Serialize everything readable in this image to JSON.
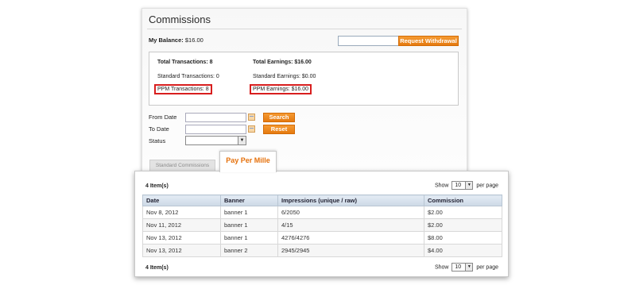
{
  "page": {
    "title": "Commissions",
    "balance_label": "My Balance:",
    "balance_value": "$16.00",
    "withdraw_button": "Request Withdrawal",
    "withdraw_amount": ""
  },
  "summary": {
    "total_transactions": "Total Transactions: 8",
    "standard_transactions": "Standard Transactions: 0",
    "ppm_transactions": "PPM Transactions: 8",
    "total_earnings": "Total Earnings: $16.00",
    "standard_earnings": "Standard Earnings: $0.00",
    "ppm_earnings": "PPM Earnings: $16.00"
  },
  "filters": {
    "from_label": "From Date",
    "to_label": "To Date",
    "status_label": "Status",
    "from_value": "",
    "to_value": "",
    "status_value": "",
    "search_button": "Search",
    "reset_button": "Reset"
  },
  "tabs": {
    "standard": "Standard Commissions",
    "ppm": "Pay Per Mille"
  },
  "grid": {
    "count_top": "4 Item(s)",
    "count_bottom": "4 Item(s)",
    "show_label": "Show",
    "per_page_label": "per page",
    "per_page_value": "10",
    "columns": [
      "Date",
      "Banner",
      "Impressions (unique / raw)",
      "Commission"
    ],
    "rows": [
      [
        "Nov 8, 2012",
        "banner 1",
        "6/2050",
        "$2.00"
      ],
      [
        "Nov 11, 2012",
        "banner 1",
        "4/15",
        "$2.00"
      ],
      [
        "Nov 13, 2012",
        "banner 1",
        "4276/4276",
        "$8.00"
      ],
      [
        "Nov 13, 2012",
        "banner 2",
        "2945/2945",
        "$4.00"
      ]
    ]
  },
  "colors": {
    "accent_orange": "#e57a10",
    "highlight_red": "#d81e1e",
    "header_blue": "#cdd9e6"
  }
}
